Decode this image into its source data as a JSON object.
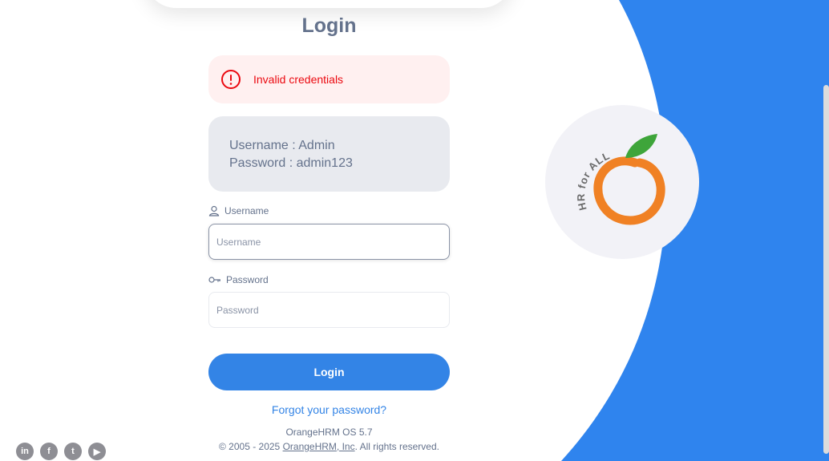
{
  "page": {
    "title": "Login",
    "accent_color": "#3384e6",
    "error_color": "#eb0910"
  },
  "alert": {
    "icon": "alert-circle-icon",
    "message": "Invalid credentials"
  },
  "credentials_hint": {
    "username_line": "Username : Admin",
    "password_line": "Password : admin123"
  },
  "form": {
    "username": {
      "label": "Username",
      "placeholder": "Username",
      "value": "",
      "icon": "user-icon"
    },
    "password": {
      "label": "Password",
      "placeholder": "Password",
      "value": "",
      "icon": "key-icon"
    },
    "submit_label": "Login",
    "forgot_link": "Forgot your password?"
  },
  "footer": {
    "version": "OrangeHRM OS 5.7",
    "copyright_prefix": "© 2005 - 2025 ",
    "company_link": "OrangeHRM, Inc",
    "copyright_suffix": ". All rights reserved."
  },
  "logo": {
    "tagline": "HR for ALL"
  },
  "social": [
    {
      "name": "linkedin-icon",
      "glyph": "in"
    },
    {
      "name": "facebook-icon",
      "glyph": "f"
    },
    {
      "name": "twitter-icon",
      "glyph": "t"
    },
    {
      "name": "youtube-icon",
      "glyph": "▶"
    }
  ]
}
